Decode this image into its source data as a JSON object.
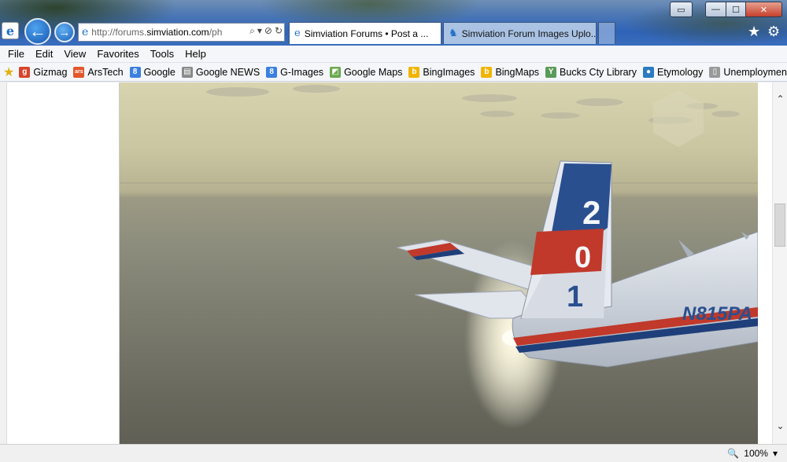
{
  "window": {
    "minimize": "—",
    "maximize": "☐",
    "close": "✕",
    "restore_page_icon": "▭"
  },
  "nav": {
    "back_icon": "←",
    "forward_icon": "→",
    "address": {
      "prefix": "http://forums.",
      "domain": "simviation.com",
      "suffix": "/ph"
    },
    "addr_icons": [
      "⌕",
      "▾",
      "⊘",
      "↻"
    ]
  },
  "tabs": [
    {
      "label": "Simviation Forums • Post a ...",
      "close": "✕"
    },
    {
      "label": "Simviation Forum Images Uplo..."
    }
  ],
  "menu": [
    "File",
    "Edit",
    "View",
    "Favorites",
    "Tools",
    "Help"
  ],
  "favorites": [
    {
      "label": "Gizmag",
      "icon": "g",
      "color": "#d6452b"
    },
    {
      "label": "ArsTech",
      "icon": "ars",
      "color": "#e2572a"
    },
    {
      "label": "Google",
      "icon": "8",
      "color": "#3b7fe0"
    },
    {
      "label": "Google NEWS",
      "icon": "▤",
      "color": "#8a8a8a"
    },
    {
      "label": "G-Images",
      "icon": "8",
      "color": "#3b7fe0"
    },
    {
      "label": "Google Maps",
      "icon": "◩",
      "color": "#6aa84f"
    },
    {
      "label": "BingImages",
      "icon": "b",
      "color": "#f2b400"
    },
    {
      "label": "BingMaps",
      "icon": "b",
      "color": "#f2b400"
    },
    {
      "label": "Bucks Cty Library",
      "icon": "Y",
      "color": "#5a9a5a"
    },
    {
      "label": "Etymology",
      "icon": "●",
      "color": "#2a7bbf"
    },
    {
      "label": "Unemployment",
      "icon": "▯",
      "color": "#999999"
    }
  ],
  "airplane": {
    "tail_numbers": [
      "2",
      "0",
      "1"
    ],
    "registration": "N815PA"
  },
  "status": {
    "zoom": "100%"
  }
}
